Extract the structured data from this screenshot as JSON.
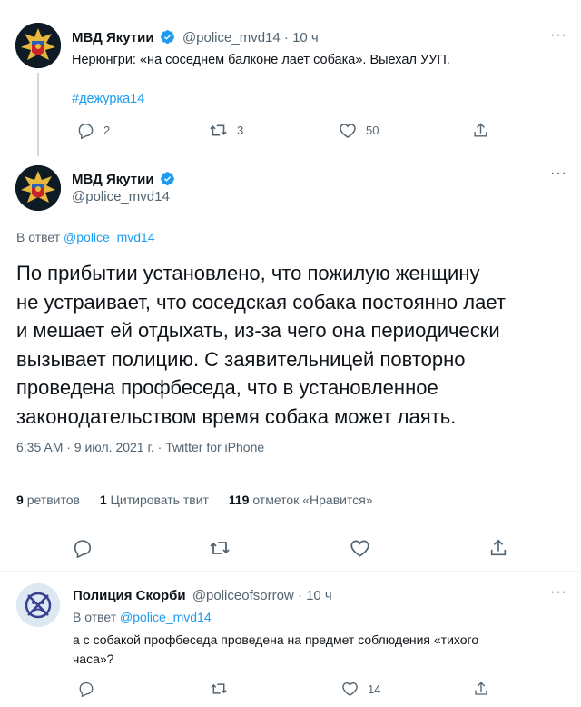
{
  "tweet1": {
    "display_name": "МВД Якутии",
    "handle": "@police_mvd14",
    "time": "10 ч",
    "text": "Нерюнгри:  «на соседнем балконе лает собака». Выехал УУП.",
    "hashtag": "#дежурка14",
    "replies": "2",
    "retweets": "3",
    "likes": "50"
  },
  "main": {
    "display_name": "МВД Якутии",
    "handle": "@police_mvd14",
    "reply_prefix": "В ответ",
    "reply_to": "@police_mvd14",
    "text_lines": [
      "По прибытии установлено, что пожилую женщину",
      "не устраивает, что соседская собака постоянно лает",
      "и мешает ей отдыхать, из-за чего она периодически",
      "вызывает полицию. С заявительницей повторно",
      "проведена профбеседа, что в установленное",
      "законодательством время собака может лаять."
    ],
    "meta": "6:35 AM · 9 июл. 2021 г. · Twitter for iPhone",
    "stats": {
      "retweets_num": "9",
      "retweets_label": "ретвитов",
      "quotes_num": "1",
      "quotes_label": "Цитировать твит",
      "likes_num": "119",
      "likes_label": "отметок «Нравится»"
    }
  },
  "reply": {
    "display_name": "Полиция Скорби",
    "handle": "@policeofsorrow",
    "time": "· 10 ч",
    "reply_prefix": "В ответ",
    "reply_to": "@police_mvd14",
    "text_line1": "а с собакой профбеседа проведена на предмет соблюдения «тихого",
    "text_line2": "часа»?",
    "likes": "14"
  },
  "colors": {
    "accent": "#1d9bf0",
    "muted": "#536471",
    "text": "#0f1419"
  }
}
